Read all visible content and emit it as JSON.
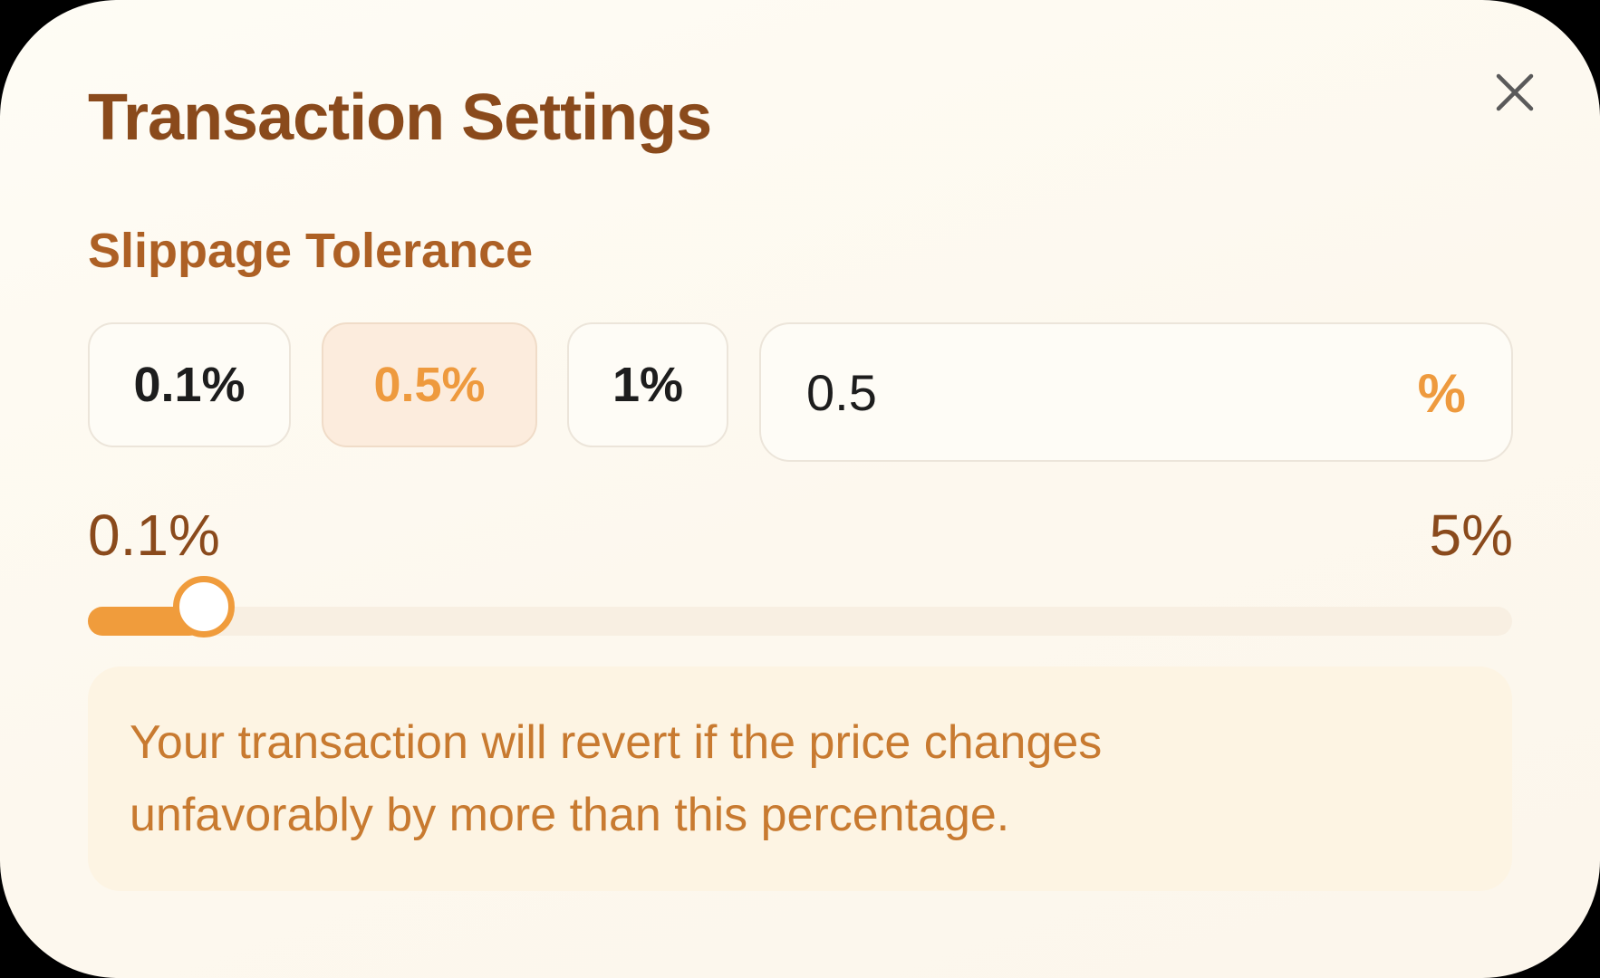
{
  "dialog": {
    "title": "Transaction Settings",
    "close_icon": "close-icon"
  },
  "slippage": {
    "label": "Slippage Tolerance",
    "presets": [
      {
        "label": "0.1%",
        "selected": false
      },
      {
        "label": "0.5%",
        "selected": true
      },
      {
        "label": "1%",
        "selected": false
      }
    ],
    "custom_value": "0.5",
    "custom_suffix": "%",
    "range_min_label": "0.1%",
    "range_max_label": "5%",
    "range_min": 0.1,
    "range_max": 5,
    "current_value": 0.5,
    "info_text": "Your transaction will revert if the price changes unfavorably by more than this percentage."
  },
  "colors": {
    "title": "#8a4a1c",
    "accent": "#f09c3c",
    "info_text": "#c87a30",
    "background": "#fefcf5"
  }
}
